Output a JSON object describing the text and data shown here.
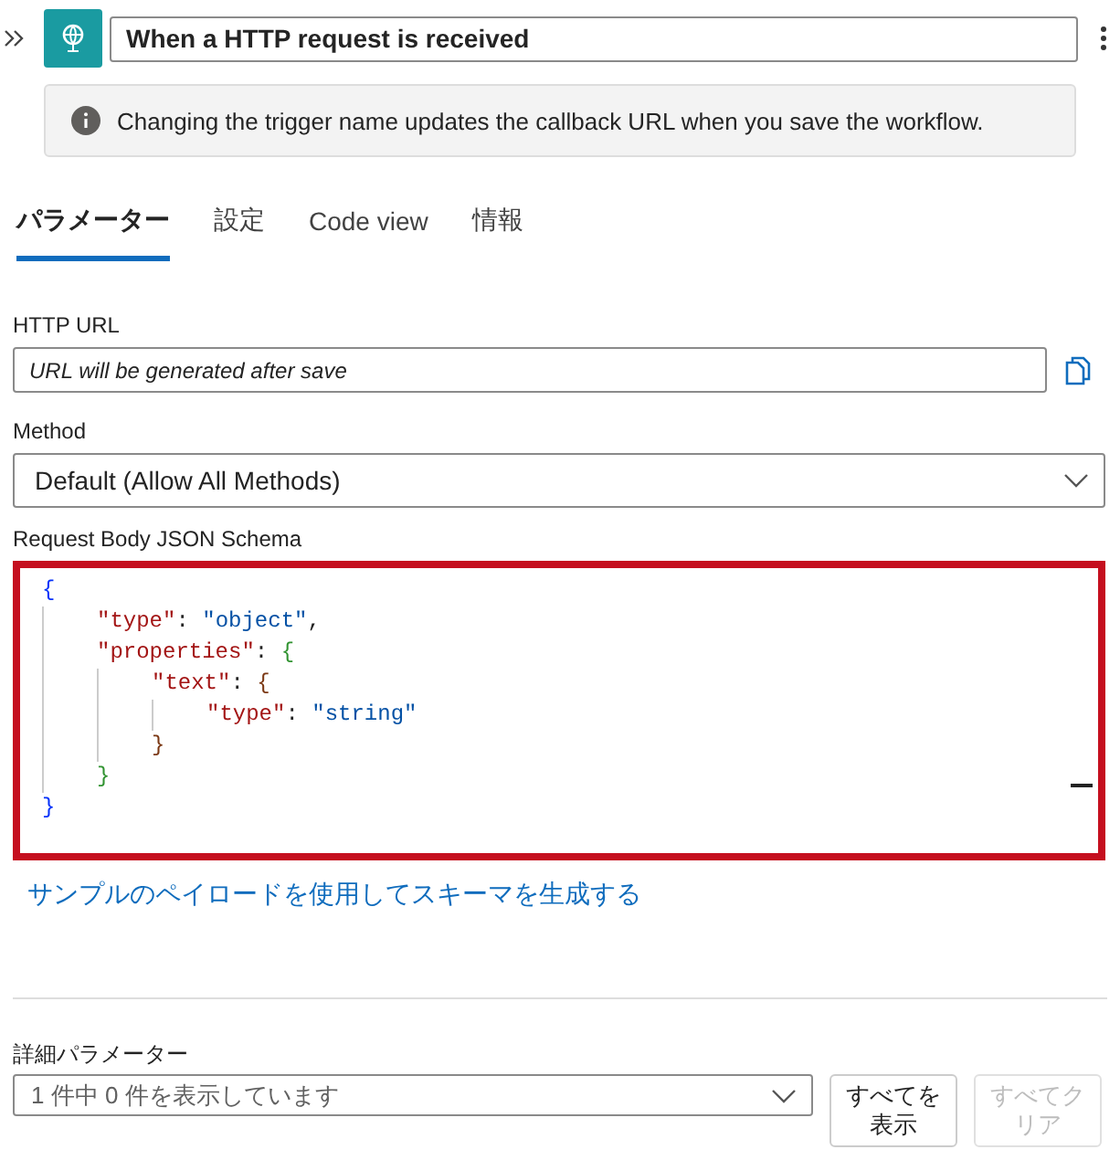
{
  "header": {
    "title": "When a HTTP request is received"
  },
  "info": {
    "text": "Changing the trigger name updates the callback URL when you save the workflow."
  },
  "tabs": [
    {
      "label": "パラメーター",
      "selected": true
    },
    {
      "label": "設定",
      "selected": false
    },
    {
      "label": "Code view",
      "selected": false
    },
    {
      "label": "情報",
      "selected": false
    }
  ],
  "http_url": {
    "label": "HTTP URL",
    "value": "URL will be generated after save"
  },
  "method": {
    "label": "Method",
    "value": "Default (Allow All Methods)"
  },
  "schema": {
    "label": "Request Body JSON Schema",
    "highlighted": true,
    "code": {
      "open": [
        {
          "kind": "brace",
          "text": "{"
        }
      ],
      "children": [
        {
          "tokens": [
            {
              "kind": "key",
              "text": "\"type\""
            },
            {
              "kind": "punct",
              "text": ": "
            },
            {
              "kind": "string",
              "text": "\"object\""
            },
            {
              "kind": "punct",
              "text": ","
            }
          ]
        },
        {
          "open": [
            {
              "kind": "key",
              "text": "\"properties\""
            },
            {
              "kind": "punct",
              "text": ": "
            },
            {
              "kind": "brace",
              "text": "{"
            }
          ],
          "children": [
            {
              "open": [
                {
                  "kind": "key",
                  "text": "\"text\""
                },
                {
                  "kind": "punct",
                  "text": ": "
                },
                {
                  "kind": "brace",
                  "text": "{"
                }
              ],
              "children": [
                {
                  "tokens": [
                    {
                      "kind": "key",
                      "text": "\"type\""
                    },
                    {
                      "kind": "punct",
                      "text": ": "
                    },
                    {
                      "kind": "string",
                      "text": "\"string\""
                    }
                  ]
                }
              ],
              "close": [
                {
                  "kind": "brace",
                  "text": "}"
                }
              ]
            }
          ],
          "close": [
            {
              "kind": "brace",
              "text": "}"
            }
          ]
        }
      ],
      "close": [
        {
          "kind": "brace",
          "text": "}"
        }
      ]
    }
  },
  "sample_link": "サンプルのペイロードを使用してスキーマを生成する",
  "advanced": {
    "label": "詳細パラメーター",
    "value": "1 件中 0 件を表示しています",
    "buttons": [
      {
        "label": "すべてを表示",
        "disabled": false
      },
      {
        "label": "すべてクリア",
        "disabled": true
      }
    ]
  }
}
